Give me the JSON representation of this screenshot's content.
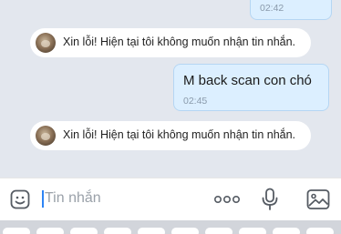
{
  "messages": [
    {
      "type": "outgoing",
      "text": "",
      "time": "02:42"
    },
    {
      "type": "system",
      "text": "Xin lỗi! Hiện tại tôi không muốn nhận tin nhắn."
    },
    {
      "type": "outgoing",
      "text": "M back scan con chó",
      "time": "02:45"
    },
    {
      "type": "system",
      "text": "Xin lỗi! Hiện tại tôi không muốn nhận tin nhắn."
    }
  ],
  "input_bar": {
    "placeholder": "Tin nhắn",
    "icons": [
      "sticker-icon",
      "more-icon",
      "microphone-icon",
      "image-icon"
    ]
  },
  "colors": {
    "chat_background": "#e3e7ee",
    "outgoing_bubble": "#dcefff",
    "outgoing_border": "#b5d6f3",
    "accent": "#2d84f5"
  }
}
